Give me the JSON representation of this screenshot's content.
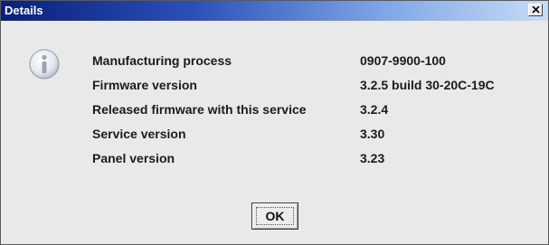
{
  "window": {
    "title": "Details"
  },
  "icons": {
    "close": "close-icon",
    "info": "info-icon"
  },
  "details": [
    {
      "label": "Manufacturing process",
      "value": "0907-9900-100"
    },
    {
      "label": "Firmware version",
      "value": "3.2.5 build 30-20C-19C"
    },
    {
      "label": "Released firmware with this service",
      "value": "3.2.4"
    },
    {
      "label": "Service version",
      "value": "3.30"
    },
    {
      "label": "Panel version",
      "value": "3.23"
    }
  ],
  "buttons": {
    "ok_label": "OK"
  },
  "colors": {
    "titlebar_start": "#0a1f7a",
    "titlebar_end": "#c7dcf6",
    "dialog_bg": "#e9e9e9"
  }
}
